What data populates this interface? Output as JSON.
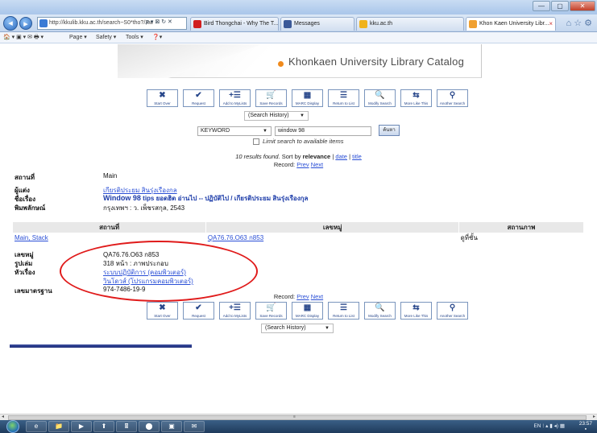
{
  "browser": {
    "address": "http://kkulib.kku.ac.th/search~S0*tho?/Xw",
    "address_bold": "kku.ac.th",
    "address_controls": "ρ ▾ ⊠ ↻ ✕",
    "tabs": [
      {
        "label": "Bird Thongchai - Why The T...",
        "color": "#d11e1e"
      },
      {
        "label": "Messages",
        "color": "#3b5998"
      },
      {
        "label": "kku.ac.th",
        "color": "#f0b21a"
      },
      {
        "label": "Khon Kaen University Libr...",
        "color": "#f0a030",
        "active": true
      }
    ],
    "tab_close": "×",
    "window_buttons": [
      "—",
      "▢",
      "✕"
    ],
    "nav_right_icons": "⌂ ☆ ⚙",
    "commands": [
      "Page ▾",
      "Safety ▾",
      "Tools ▾",
      "❓▾"
    ]
  },
  "catalog": {
    "header_title": "Khonkaen University Library Catalog",
    "toolbar": [
      {
        "label": "Start Over",
        "glyph": "✖"
      },
      {
        "label": "Request",
        "glyph": "✔"
      },
      {
        "label": "Add to MyLists",
        "glyph": "+☰"
      },
      {
        "label": "Save Records",
        "glyph": "🛒"
      },
      {
        "label": "MARC Display",
        "glyph": "▦"
      },
      {
        "label": "Return to List",
        "glyph": "☰"
      },
      {
        "label": "Modify Search",
        "glyph": "🔍"
      },
      {
        "label": "More Like This",
        "glyph": "⇆"
      },
      {
        "label": "Another Search",
        "glyph": "⚲"
      }
    ],
    "history_label": "(Search History)",
    "search": {
      "index": "KEYWORD",
      "query": "window 98",
      "button": "ค้นหา",
      "limit_label": "Limit search to available items"
    },
    "results": {
      "count_text": "10 results found.",
      "sort_by_label": "Sort by",
      "sort_current": "relevance",
      "sort_date": "date",
      "sort_title": "title",
      "separator": "|",
      "record_label": "Record:",
      "prev": "Prev",
      "next": "Next"
    },
    "record": {
      "location_label": "สถานที่",
      "location_value": "Main",
      "author_label": "ผู้แต่ง",
      "author_value": "เกียรติประยม สินรุ่งเรืองกล",
      "title_label": "ชื่อเรื่อง",
      "title_bold": "Window 98",
      "title_rest": "tips ยอดฮิต อ่านไป -- ปฏิบัติไป / เกียรติประยม สินรุ่งเรืองกุล",
      "publisher_label": "พิมพลักษณ์",
      "publisher_value": "กรุงเทพฯ : ว. เพ็ชรสกุล, 2543"
    },
    "holdings": {
      "headers": [
        "สถานที่",
        "เลขหมู่",
        "สถานภาพ"
      ],
      "row": {
        "location": "Main, Stack",
        "call_number": "QA76.76.O63 ก853",
        "status": "ดูที่ชั้น"
      }
    },
    "details": {
      "call_label": "เลขหมู่",
      "call_value": "QA76.76.O63 ก853",
      "format_label": "รูปเล่ม",
      "format_value": "318 หน้า : ภาพประกอบ",
      "subject_label": "หัวเรื่อง",
      "subject_1": "ระบบปฏิบัติการ (คอมพิวเตอร์)",
      "subject_2": "วินโดวส์ (โปรแกรมคอมพิวเตอร์)",
      "isbn_label": "เลขมาตรฐาน",
      "isbn_value": "974-7486-19-9"
    }
  },
  "taskbar": {
    "tray": "EN  ⁝  ▴  ▮  ◂)  ▦",
    "time": "23:57",
    "tasks": [
      "e",
      "📁",
      "▶",
      "⬆",
      "🖩",
      "⬤",
      "▣",
      "✉"
    ],
    "scroll_left": "◂",
    "scroll_mid": "≡",
    "scroll_right": "▸"
  },
  "colors": {
    "annotation": "#e01b1b",
    "link": "#2a4fd6",
    "title": "#1a3aa8"
  }
}
